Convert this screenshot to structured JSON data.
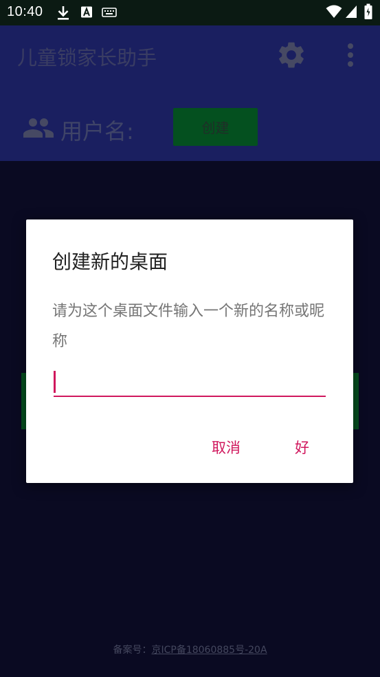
{
  "status_bar": {
    "time": "10:40",
    "icons": [
      "download-icon",
      "font-a-icon",
      "keyboard-icon",
      "wifi-icon",
      "signal-icon",
      "battery-icon"
    ]
  },
  "app_bar": {
    "title": "儿童锁家长助手",
    "actions": [
      "settings-icon",
      "overflow-menu-icon"
    ]
  },
  "user_section": {
    "label": "用户名:",
    "create_button": "创建"
  },
  "dialog": {
    "title": "创建新的桌面",
    "message": "请为这个桌面文件输入一个新的名称或昵称",
    "input_value": "",
    "cancel_label": "取消",
    "ok_label": "好"
  },
  "footer": {
    "prefix": "备案号：",
    "icp": "京ICP备18060885号-20A"
  },
  "colors": {
    "status_bar_bg": "#0b1a13",
    "app_bar_bg": "#1a1f60",
    "screen_bg": "#0a0a22",
    "button_green": "#04501f",
    "accent": "#d0175d"
  }
}
